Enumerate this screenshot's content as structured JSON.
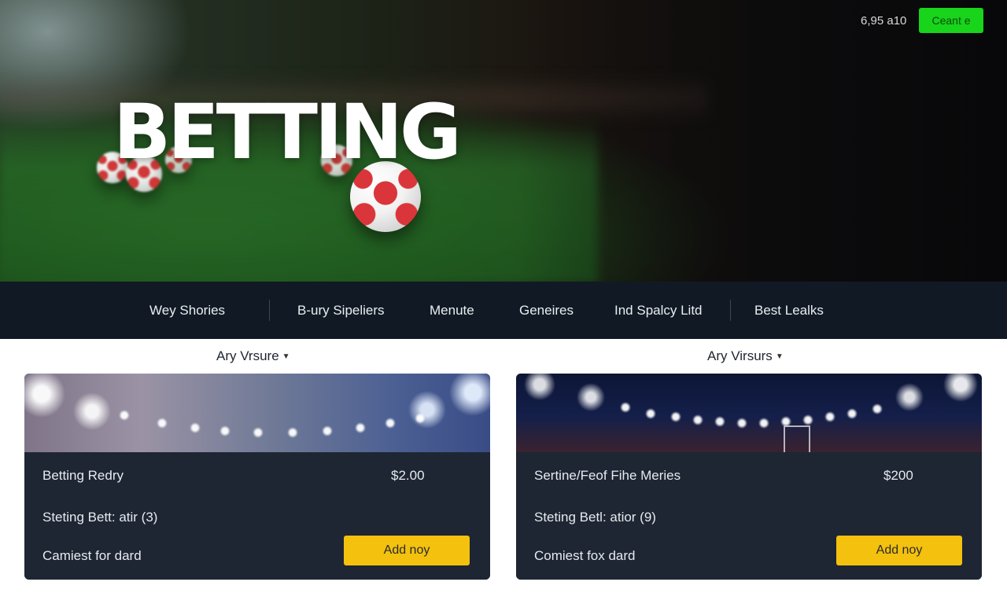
{
  "header": {
    "hero_title": "BETTING",
    "top_right_text": "6,95 a10",
    "top_cta_label": "Ceant e"
  },
  "nav": {
    "items": [
      "Wey Shories",
      "B-ury Sipeliers",
      "Menute",
      "Geneires",
      "Ind Spalcy Litd",
      "Best Lealks"
    ]
  },
  "main": {
    "left": {
      "dropdown_label": "Ary Vrsure",
      "rows": [
        "Betting Redry",
        "Steting Bett: atir (3)",
        "Camiest for dard"
      ],
      "price": "$2.00",
      "button_label": "Add noy"
    },
    "right": {
      "dropdown_label": "Ary Virsurs",
      "rows": [
        "Sertine/Feof Fihe Meries",
        "Steting Betl: atior (9)",
        "Comiest fox dard"
      ],
      "price": "$200",
      "button_label": "Add noy"
    }
  },
  "colors": {
    "nav_bg": "#111a24",
    "card_bg": "#1e2633",
    "accent_green": "#18d41a",
    "accent_yellow": "#f3c10e"
  }
}
